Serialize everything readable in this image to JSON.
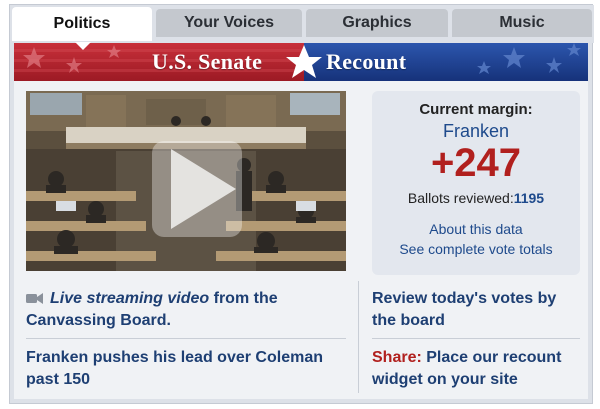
{
  "tabs": [
    {
      "label": "Politics",
      "active": true
    },
    {
      "label": "Your Voices",
      "active": false
    },
    {
      "label": "Graphics",
      "active": false
    },
    {
      "label": "Music",
      "active": false
    }
  ],
  "banner": {
    "left_text": "U.S. Senate",
    "right_text": "Recount",
    "left_color": "#b3202a",
    "right_color": "#1d3f8f"
  },
  "margin": {
    "title": "Current margin:",
    "leader": "Franken",
    "value": "+247",
    "ballots_label": "Ballots reviewed:",
    "ballots_value": "1195",
    "about_link": "About this data",
    "totals_link": "See complete vote totals"
  },
  "video": {
    "play_icon": "play-icon",
    "caption_italic": "Live streaming video",
    "caption_rest": " from the Canvassing Board.",
    "camera_icon": "video-camera-icon"
  },
  "links": {
    "review_votes": "Review today's votes by the board",
    "headline": "Franken pushes his lead over Coleman past 150",
    "share_label": "Share:",
    "share_text": " Place our recount widget on your site"
  },
  "colors": {
    "link_blue": "#1e3f73",
    "accent_red": "#b1201e",
    "panel_bg": "#f0f2f5"
  }
}
